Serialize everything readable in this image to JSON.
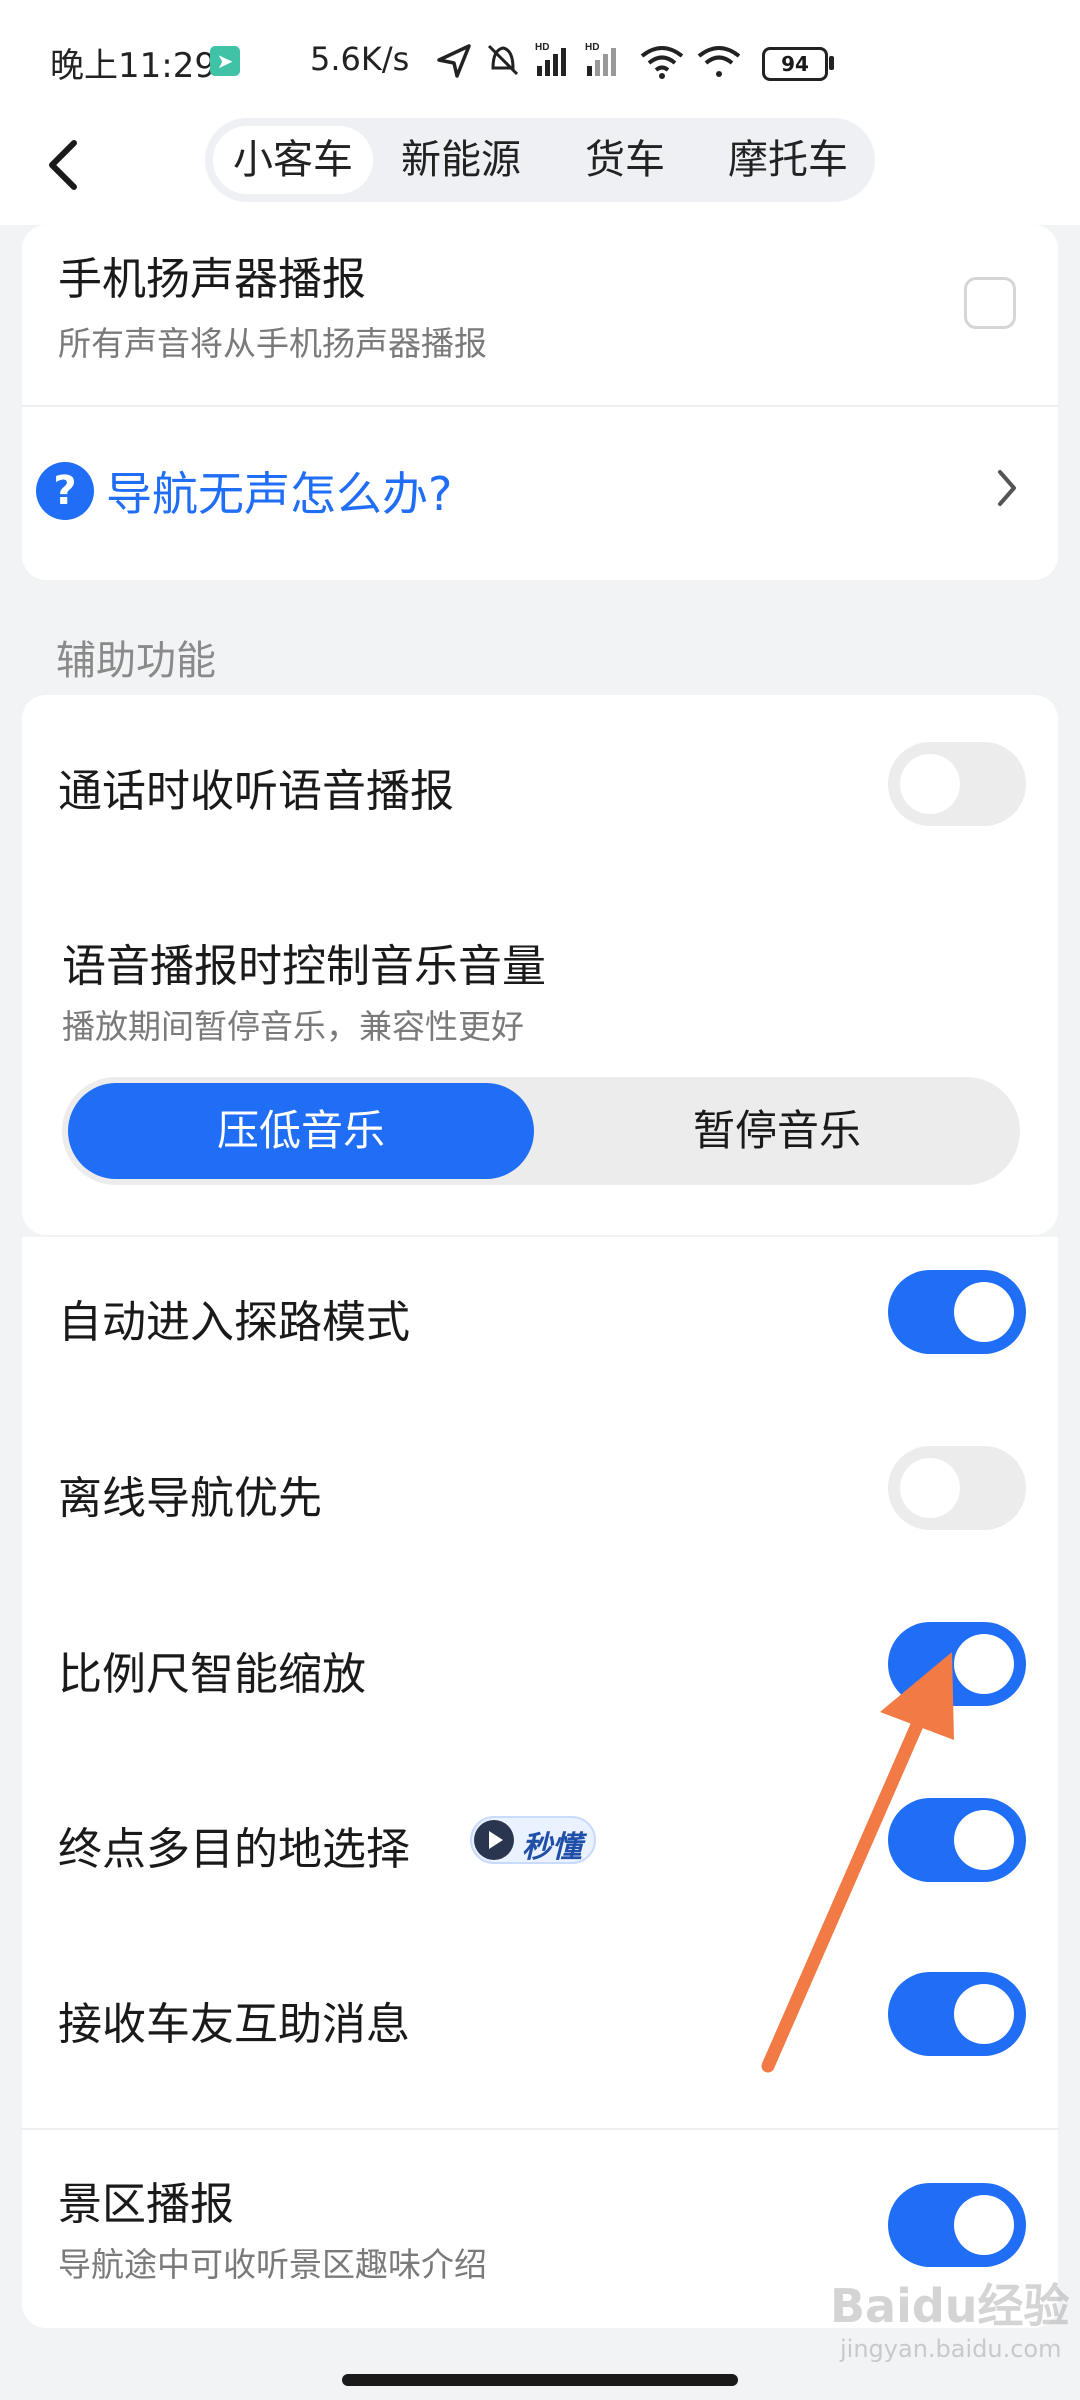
{
  "status_bar": {
    "time": "晚上11:29",
    "network_speed": "5.6K/s",
    "battery": "94",
    "icons": [
      "location-icon",
      "mute-bell-icon",
      "hd-signal-icon",
      "hd-signal-icon",
      "wifi-icon",
      "wifi-link-icon"
    ]
  },
  "header": {
    "tabs": [
      {
        "label": "小客车",
        "active": true
      },
      {
        "label": "新能源",
        "active": false
      },
      {
        "label": "货车",
        "active": false
      },
      {
        "label": "摩托车",
        "active": false
      }
    ]
  },
  "speaker_card": {
    "title": "手机扬声器播报",
    "subtitle": "所有声音将从手机扬声器播报",
    "checked": false,
    "help_link": "导航无声怎么办?"
  },
  "section": {
    "label": "辅助功能"
  },
  "settings": {
    "call_voice": {
      "title": "通话时收听语音播报",
      "on": false
    },
    "music_control": {
      "title": "语音播报时控制音乐音量",
      "subtitle": "播放期间暂停音乐，兼容性更好",
      "options": [
        "压低音乐",
        "暂停音乐"
      ],
      "selected": "压低音乐"
    },
    "explore_mode": {
      "title": "自动进入探路模式",
      "on": true
    },
    "offline_nav": {
      "title": "离线导航优先",
      "on": false
    },
    "smart_zoom": {
      "title": "比例尺智能缩放",
      "on": true
    },
    "multi_destination": {
      "title": "终点多目的地选择",
      "badge": "秒懂",
      "on": true
    },
    "rider_messages": {
      "title": "接收车友互助消息",
      "on": true
    },
    "scenic_broadcast": {
      "title": "景区播报",
      "subtitle": "导航途中可收听景区趣味介绍",
      "on": true
    }
  },
  "watermark": {
    "text": "Baidu经验",
    "sub": "jingyan.baidu.com"
  },
  "colors": {
    "accent": "#1f6ef5",
    "arrow": "#f27a45",
    "toggle_off": "#ececec"
  }
}
